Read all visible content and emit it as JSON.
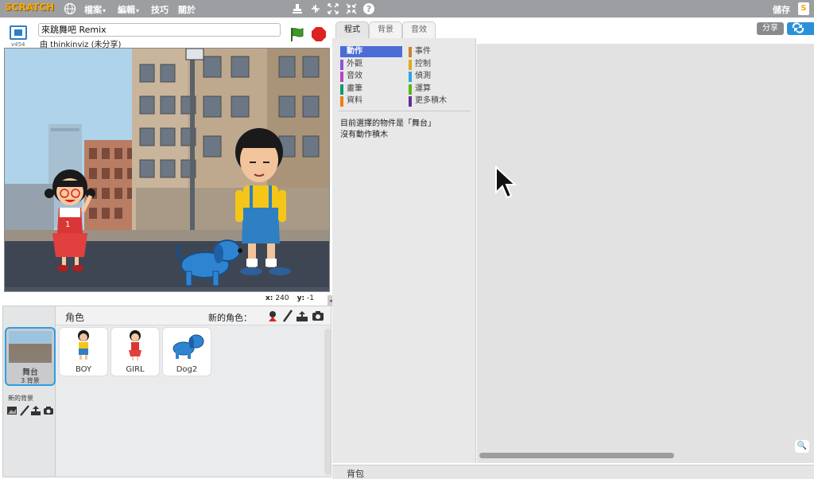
{
  "menubar": {
    "logo": "SCRATCH",
    "menus": [
      {
        "label": "檔案",
        "caret": "▾"
      },
      {
        "label": "編輯",
        "caret": "▾"
      },
      {
        "label": "技巧"
      },
      {
        "label": "關於"
      }
    ],
    "save_label": "儲存",
    "user_initial": "S"
  },
  "stage": {
    "version": "v454",
    "project_title": "來跳舞吧 Remix",
    "byline": "由 thinkinviz (未分享)",
    "coords": {
      "x_label": "x:",
      "x": "240",
      "y_label": "y:",
      "y": "-1"
    }
  },
  "sprites": {
    "header_label": "角色",
    "new_sprite_label": "新的角色：",
    "stage_item": {
      "name": "舞台",
      "sub": "3 背景"
    },
    "items": [
      {
        "name": "BOY"
      },
      {
        "name": "GIRL"
      },
      {
        "name": "Dog2"
      }
    ],
    "new_backdrop_label": "新的背景"
  },
  "editor": {
    "tabs": [
      "程式",
      "背景",
      "音效"
    ],
    "active_tab": 0,
    "share_label": "分享",
    "see_project_label": ""
  },
  "palette": {
    "categories_left": [
      {
        "label": "動作",
        "color": "#4a6cd4",
        "selected": true
      },
      {
        "label": "外觀",
        "color": "#8a55d7"
      },
      {
        "label": "音效",
        "color": "#bb42c3"
      },
      {
        "label": "畫筆",
        "color": "#0e9a6c"
      },
      {
        "label": "資料",
        "color": "#ee7d16"
      }
    ],
    "categories_right": [
      {
        "label": "事件",
        "color": "#c88330"
      },
      {
        "label": "控制",
        "color": "#e1a91a"
      },
      {
        "label": "偵測",
        "color": "#2ca5e2"
      },
      {
        "label": "運算",
        "color": "#5cb712"
      },
      {
        "label": "更多積木",
        "color": "#632d99"
      }
    ],
    "message_line1": "目前選擇的物件是「舞台」",
    "message_line2": "沒有動作積木"
  },
  "backpack": {
    "label": "背包"
  },
  "colors": {
    "accent": "#2d9ee6",
    "menubar": "#9c9ea2"
  }
}
